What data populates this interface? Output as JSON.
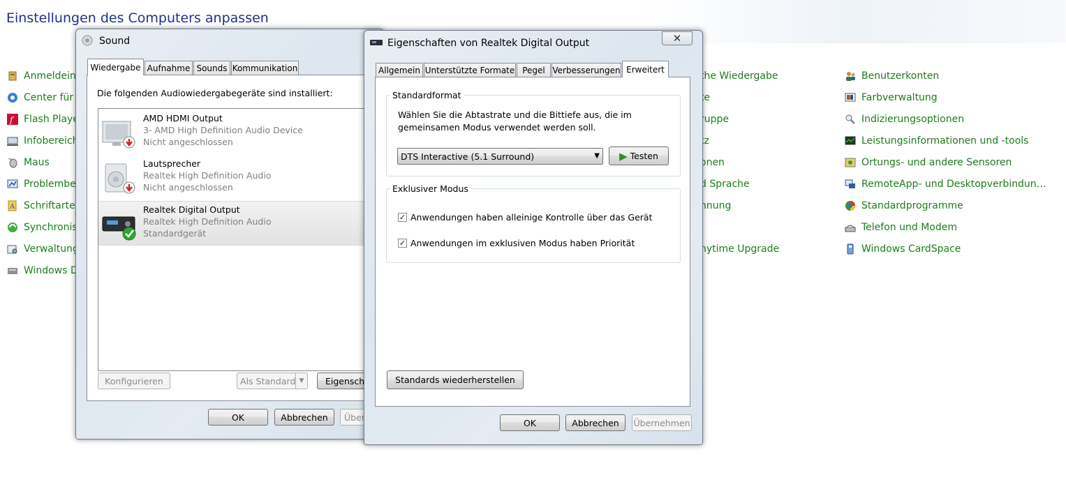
{
  "control_panel": {
    "title": "Einstellungen des Computers anpassen",
    "left_column": [
      "Anmeldein",
      "Center für e",
      "Flash Playe",
      "Infobereich",
      "Maus",
      "Problembe",
      "Schriftarter",
      "Synchronisi",
      "Verwaltung",
      "Windows D"
    ],
    "middle_column": [
      "the Wiedergabe",
      "te",
      "ruppe",
      "tz",
      "onen",
      "d Sprache",
      "nnung",
      "",
      "nytime Upgrade"
    ],
    "right_column": [
      "Benutzerkonten",
      "Farbverwaltung",
      "Indizierungsoptionen",
      "Leistungsinformationen und -tools",
      "Ortungs- und andere Sensoren",
      "RemoteApp- und Desktopverbindun…",
      "Standardprogramme",
      "Telefon und Modem",
      "Windows CardSpace"
    ]
  },
  "sound_window": {
    "title": "Sound",
    "tabs": [
      "Wiedergabe",
      "Aufnahme",
      "Sounds",
      "Kommunikation"
    ],
    "description": "Die folgenden Audiowiedergabegeräte sind installiert:",
    "devices": [
      {
        "name": "AMD HDMI Output",
        "line1": "3- AMD High Definition Audio Device",
        "line2": "Nicht angeschlossen"
      },
      {
        "name": "Lautsprecher",
        "line1": "Realtek High Definition Audio",
        "line2": "Nicht angeschlossen"
      },
      {
        "name": "Realtek Digital Output",
        "line1": "Realtek High Definition Audio",
        "line2": "Standardgerät"
      }
    ],
    "buttons": {
      "configure": "Konfigurieren",
      "set_default": "Als Standard",
      "properties": "Eigenschaften",
      "ok": "OK",
      "cancel": "Abbrechen",
      "apply": "Übernehmen"
    }
  },
  "props_window": {
    "title": "Eigenschaften von Realtek Digital Output",
    "tabs": [
      "Allgemein",
      "Unterstützte Formate",
      "Pegel",
      "Verbesserungen",
      "Erweitert"
    ],
    "standard_format": {
      "label": "Standardformat",
      "description_line1": "Wählen Sie die Abtastrate und die Bittiefe aus, die im",
      "description_line2": "gemeinsamen Modus verwendet werden soll.",
      "selected_format": "DTS Interactive (5.1 Surround)",
      "test_button": "Testen"
    },
    "exclusive_mode": {
      "label": "Exklusiver Modus",
      "option1": "Anwendungen haben alleinige Kontrolle über das Gerät",
      "option1_checked": true,
      "option2": "Anwendungen im exklusiven Modus haben Priorität",
      "option2_checked": true
    },
    "restore_button": "Standards wiederherstellen",
    "buttons": {
      "ok": "OK",
      "cancel": "Abbrechen",
      "apply": "Übernehmen"
    }
  },
  "colors": {
    "link_green": "#1e7c1e",
    "title_blue": "#1e3287",
    "check_green": "#2fa52f"
  }
}
